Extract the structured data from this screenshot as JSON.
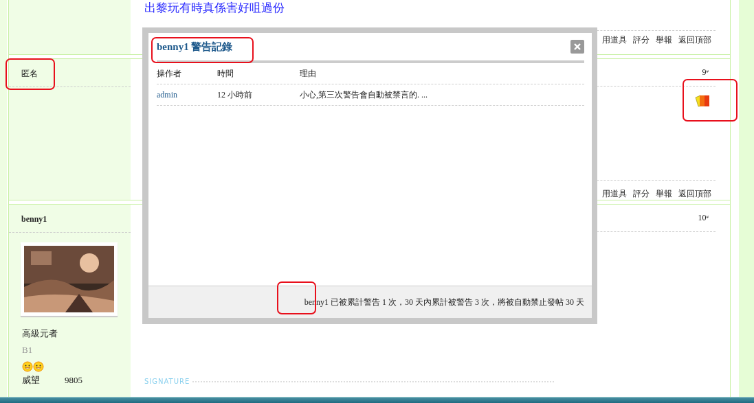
{
  "thread_title": "出黎玩有時真係害好咀過份",
  "posts": [
    {
      "kind": "tail",
      "actions": [
        "用道具",
        "評分",
        "舉報",
        "返回頂部"
      ]
    },
    {
      "kind": "short",
      "author": "匿名",
      "floor": "9$^{#}$",
      "warned": true,
      "actions": [
        "用道具",
        "評分",
        "舉報",
        "返回頂部"
      ]
    },
    {
      "kind": "full",
      "author": "benny1",
      "floor": "10$^{#}$",
      "warned": false,
      "rank": "高級元者",
      "group": "B1",
      "stats": [
        {
          "label": "威望",
          "value": "9805"
        }
      ],
      "signature_label": "SIGNATURE"
    }
  ],
  "dialog": {
    "title": "benny1 警告記錄",
    "columns": [
      "操作者",
      "時間",
      "理由"
    ],
    "rows": [
      {
        "operator": "admin",
        "time": "12 小時前",
        "reason": "小心,第三次警告會自動被禁言的. ..."
      }
    ],
    "footer": "benny1 已被累計警告 1 次，30 天內累計被警告 3 次，將被自動禁止發帖 30 天"
  }
}
